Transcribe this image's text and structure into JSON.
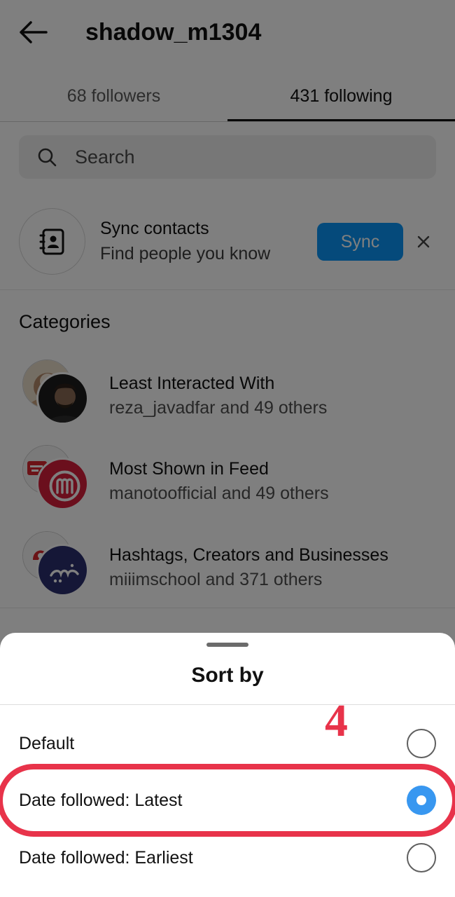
{
  "header": {
    "back_icon": "arrow-left-icon",
    "username": "shadow_m1304"
  },
  "tabs": [
    {
      "label": "68 followers",
      "active": false
    },
    {
      "label": "431 following",
      "active": true
    }
  ],
  "search": {
    "placeholder": "Search",
    "icon": "search-icon"
  },
  "sync": {
    "icon": "contacts-book-icon",
    "title": "Sync contacts",
    "subtitle": "Find people you know",
    "button_label": "Sync",
    "close_icon": "close-icon"
  },
  "categories": {
    "heading": "Categories",
    "items": [
      {
        "title": "Least Interacted With",
        "subtitle": "reza_javadfar and 49 others"
      },
      {
        "title": "Most Shown in Feed",
        "subtitle": "manotoofficial and 49 others"
      },
      {
        "title": "Hashtags, Creators and Businesses",
        "subtitle": "miiimschool and 371 others"
      }
    ]
  },
  "sort_sheet": {
    "title": "Sort by",
    "options": [
      {
        "label": "Default",
        "selected": false
      },
      {
        "label": "Date followed: Latest",
        "selected": true
      },
      {
        "label": "Date followed: Earliest",
        "selected": false
      }
    ]
  },
  "annotation": {
    "step_number": "4"
  },
  "colors": {
    "accent_blue": "#0a95f6",
    "radio_selected": "#3897f0",
    "annotation_red": "#e8334a"
  }
}
